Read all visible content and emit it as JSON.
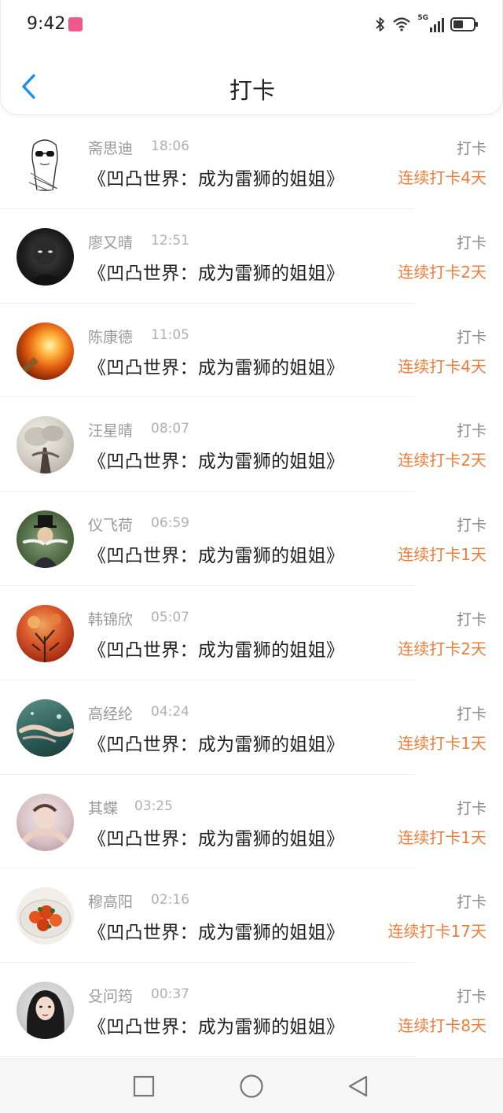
{
  "status": {
    "time": "9:42",
    "network": "5G"
  },
  "header": {
    "title": "打卡",
    "back_icon": "chevron-left-icon"
  },
  "colors": {
    "accent": "#1e8ef0",
    "streak": "#ef7d3a",
    "muted": "#9a9a9a"
  },
  "entries": [
    {
      "name": "斋思迪",
      "time": "18:06",
      "book": "《凹凸世界：成为雷狮的姐姐》",
      "action": "打卡",
      "streak": "连续打卡4天",
      "avatar": "sketch-girl-sunglasses"
    },
    {
      "name": "廖又晴",
      "time": "12:51",
      "book": "《凹凸世界：成为雷狮的姐姐》",
      "action": "打卡",
      "streak": "连续打卡2天",
      "avatar": "dark-portrait"
    },
    {
      "name": "陈康德",
      "time": "11:05",
      "book": "《凹凸世界：成为雷狮的姐姐》",
      "action": "打卡",
      "streak": "连续打卡4天",
      "avatar": "light-bulb"
    },
    {
      "name": "汪星晴",
      "time": "08:07",
      "book": "《凹凸世界：成为雷狮的姐姐》",
      "action": "打卡",
      "streak": "连续打卡2天",
      "avatar": "smoke-cloud"
    },
    {
      "name": "仪飞荷",
      "time": "06:59",
      "book": "《凹凸世界：成为雷狮的姐姐》",
      "action": "打卡",
      "streak": "连续打卡1天",
      "avatar": "top-hat-man"
    },
    {
      "name": "韩锦欣",
      "time": "05:07",
      "book": "《凹凸世界：成为雷狮的姐姐》",
      "action": "打卡",
      "streak": "连续打卡2天",
      "avatar": "autumn-tree"
    },
    {
      "name": "高经纶",
      "time": "04:24",
      "book": "《凹凸世界：成为雷狮的姐姐》",
      "action": "打卡",
      "streak": "连续打卡1天",
      "avatar": "underwater"
    },
    {
      "name": "其蝶",
      "time": "03:25",
      "book": "《凹凸世界：成为雷狮的姐姐》",
      "action": "打卡",
      "streak": "连续打卡1天",
      "avatar": "hands-portrait"
    },
    {
      "name": "穆高阳",
      "time": "02:16",
      "book": "《凹凸世界：成为雷狮的姐姐》",
      "action": "打卡",
      "streak": "连续打卡17天",
      "avatar": "food-plate"
    },
    {
      "name": "殳问筠",
      "time": "00:37",
      "book": "《凹凸世界：成为雷狮的姐姐》",
      "action": "打卡",
      "streak": "连续打卡8天",
      "avatar": "girl-portrait"
    }
  ],
  "nav": {
    "recents_icon": "square-icon",
    "home_icon": "circle-icon",
    "back_icon": "triangle-back-icon"
  }
}
